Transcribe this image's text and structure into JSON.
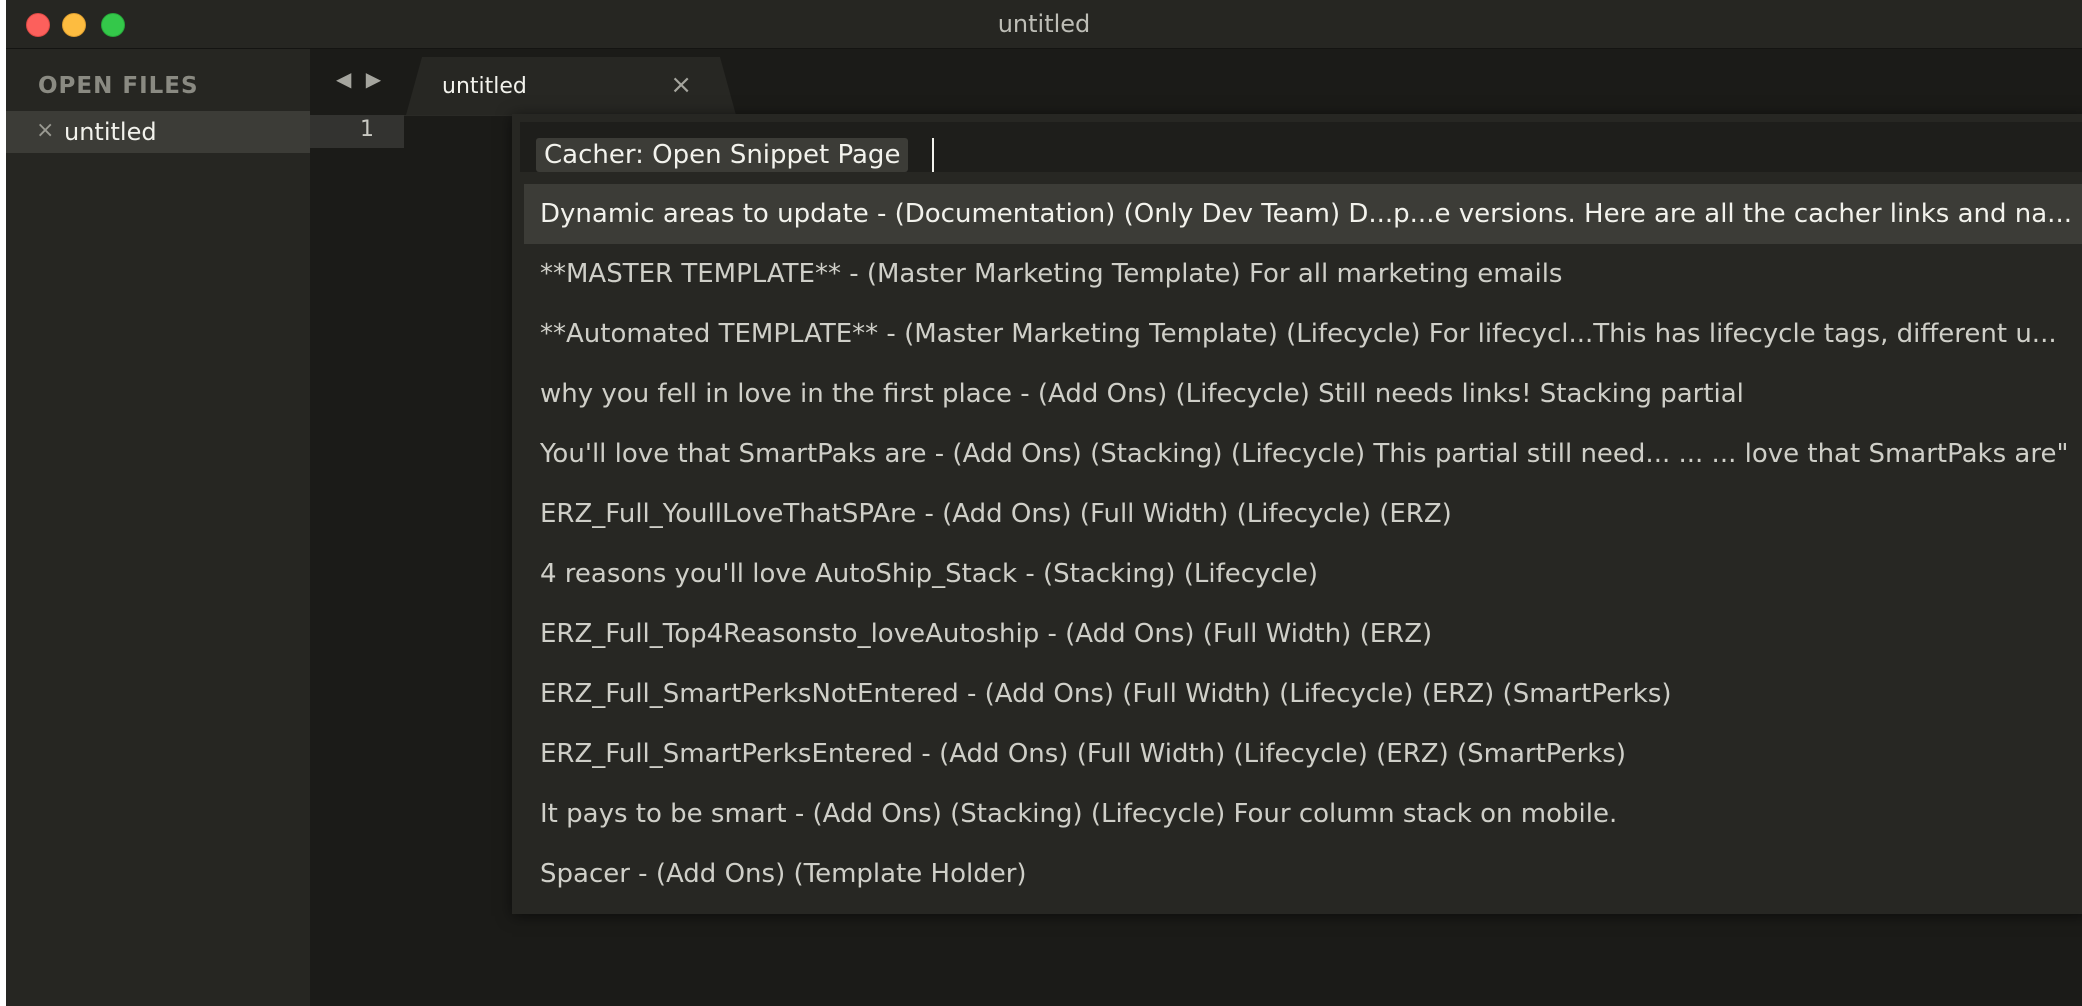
{
  "window": {
    "title": "untitled",
    "colors": {
      "close": "#fc605c",
      "minimize": "#fdbc40",
      "zoom": "#34c84a"
    }
  },
  "sidebar": {
    "header": "OPEN FILES",
    "files": [
      {
        "label": "untitled",
        "close_icon": "×"
      }
    ]
  },
  "tabs": {
    "nav_back": "◀",
    "nav_forward": "▶",
    "items": [
      {
        "label": "untitled",
        "close_icon": "×"
      }
    ]
  },
  "editor": {
    "line_numbers": [
      "1"
    ]
  },
  "palette": {
    "query": "Cacher: Open Snippet Page",
    "items": [
      "Dynamic areas to update - (Documentation) (Only Dev Team) D...p...e versions. Here are all the cacher links and na...",
      "**MASTER TEMPLATE** - (Master Marketing Template) For all marketing emails",
      "**Automated TEMPLATE** - (Master Marketing Template) (Lifecycle) For lifecycl...This has lifecycle tags, different u...",
      "why you fell in love in the first place - (Add Ons) (Lifecycle) Still needs links! Stacking partial",
      "You'll love that SmartPaks are - (Add Ons) (Stacking) (Lifecycle) This partial still need... ... ... love that SmartPaks are\"",
      "ERZ_Full_YoullLoveThatSPAre - (Add Ons) (Full Width) (Lifecycle) (ERZ)",
      "4 reasons you'll love AutoShip_Stack - (Stacking) (Lifecycle)",
      "ERZ_Full_Top4Reasonsto_loveAutoship - (Add Ons) (Full Width) (ERZ)",
      "ERZ_Full_SmartPerksNotEntered - (Add Ons) (Full Width) (Lifecycle) (ERZ) (SmartPerks)",
      "ERZ_Full_SmartPerksEntered - (Add Ons) (Full Width) (Lifecycle) (ERZ) (SmartPerks)",
      "It pays to be smart - (Add Ons) (Stacking) (Lifecycle) Four column stack on mobile.",
      "Spacer - (Add Ons) (Template Holder)"
    ]
  }
}
